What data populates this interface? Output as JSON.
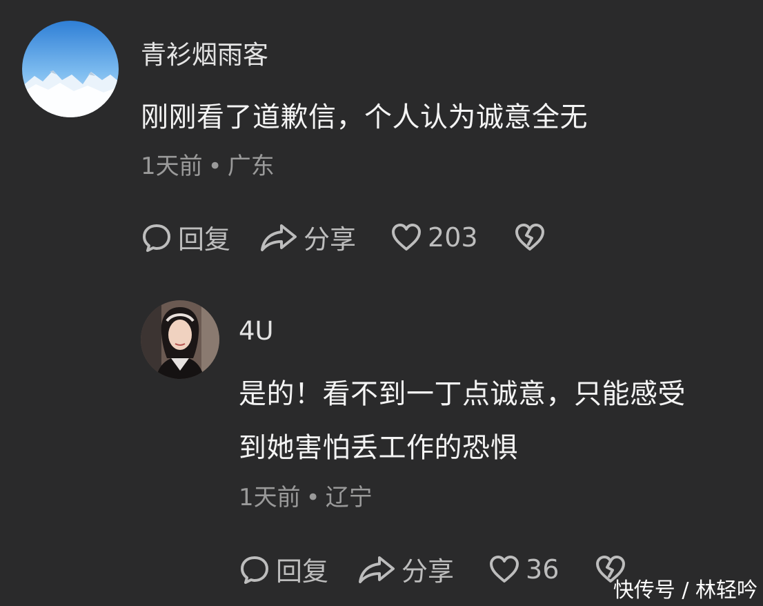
{
  "comments": [
    {
      "username": "青衫烟雨客",
      "text_lines": [
        "刚刚看了道歉信，个人认为诚意全无"
      ],
      "time": "1天前",
      "separator": "•",
      "location": "广东",
      "actions": {
        "reply_label": "回复",
        "share_label": "分享",
        "like_count": "203"
      },
      "avatar": "sky-mountain-avatar"
    },
    {
      "username": "4U",
      "text_lines": [
        "是的！看不到一丁点诚意，只能感受",
        "到她害怕丢工作的恐惧"
      ],
      "time": "1天前",
      "separator": "•",
      "location": "辽宁",
      "actions": {
        "reply_label": "回复",
        "share_label": "分享",
        "like_count": "36"
      },
      "avatar": "woman-portrait-avatar"
    }
  ],
  "watermark": "快传号 / 林轻吟",
  "icons": {
    "reply": "comment-bubble-icon",
    "share": "share-arrow-icon",
    "like": "heart-icon",
    "dislike": "broken-heart-icon"
  },
  "colors": {
    "background": "#2a2a2b",
    "text": "#f4f4f4",
    "meta": "#9a9a9a",
    "icons": "#bdbdbd"
  }
}
